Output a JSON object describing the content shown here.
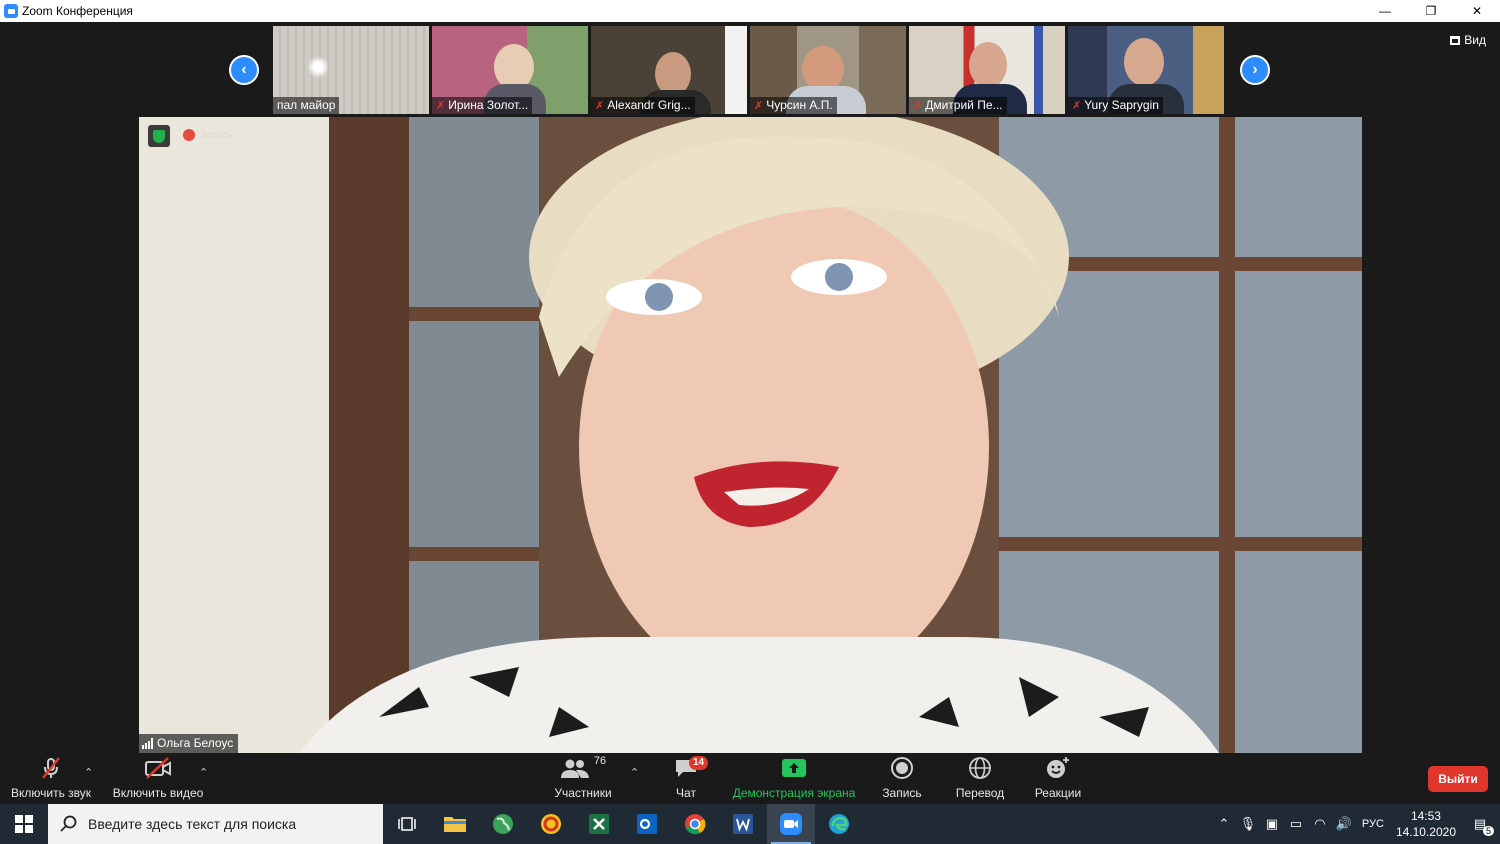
{
  "window": {
    "title": "Zoom Конференция",
    "min": "—",
    "max": "❐",
    "close": "✕"
  },
  "view": {
    "label": "Вид"
  },
  "participants_strip": [
    {
      "name": "пал майор",
      "muted": false,
      "bg": "#c9c5bf"
    },
    {
      "name": "Ирина Золот...",
      "muted": true,
      "bg": "#b8647e"
    },
    {
      "name": "Alexandr Grig...",
      "muted": true,
      "bg": "#4a4236"
    },
    {
      "name": "Чурсин А.П.",
      "muted": true,
      "bg": "#8a7a64"
    },
    {
      "name": "Дмитрий Пе...",
      "muted": true,
      "bg": "#b3a48f"
    },
    {
      "name": "Yury Saprygin",
      "muted": true,
      "bg": "#3a4a66"
    }
  ],
  "arrows": {
    "prev": "‹",
    "next": "›"
  },
  "recording": {
    "label": "Запись"
  },
  "speaker": {
    "name": "Ольга Белоус"
  },
  "toolbar": {
    "unmute": "Включить звук",
    "start_video": "Включить видео",
    "participants": "Участники",
    "participants_count": "76",
    "chat": "Чат",
    "chat_badge": "14",
    "share": "Демонстрация экрана",
    "record": "Запись",
    "translate": "Перевод",
    "reactions": "Реакции",
    "leave": "Выйти"
  },
  "colors": {
    "accent": "#2D8CFF",
    "share_green": "#22c55e",
    "danger": "#e0362c"
  },
  "taskbar": {
    "search_placeholder": "Введите здесь текст для поиска",
    "lang": "РУС",
    "time": "14:53",
    "date": "14.10.2020",
    "notifications": "5"
  }
}
